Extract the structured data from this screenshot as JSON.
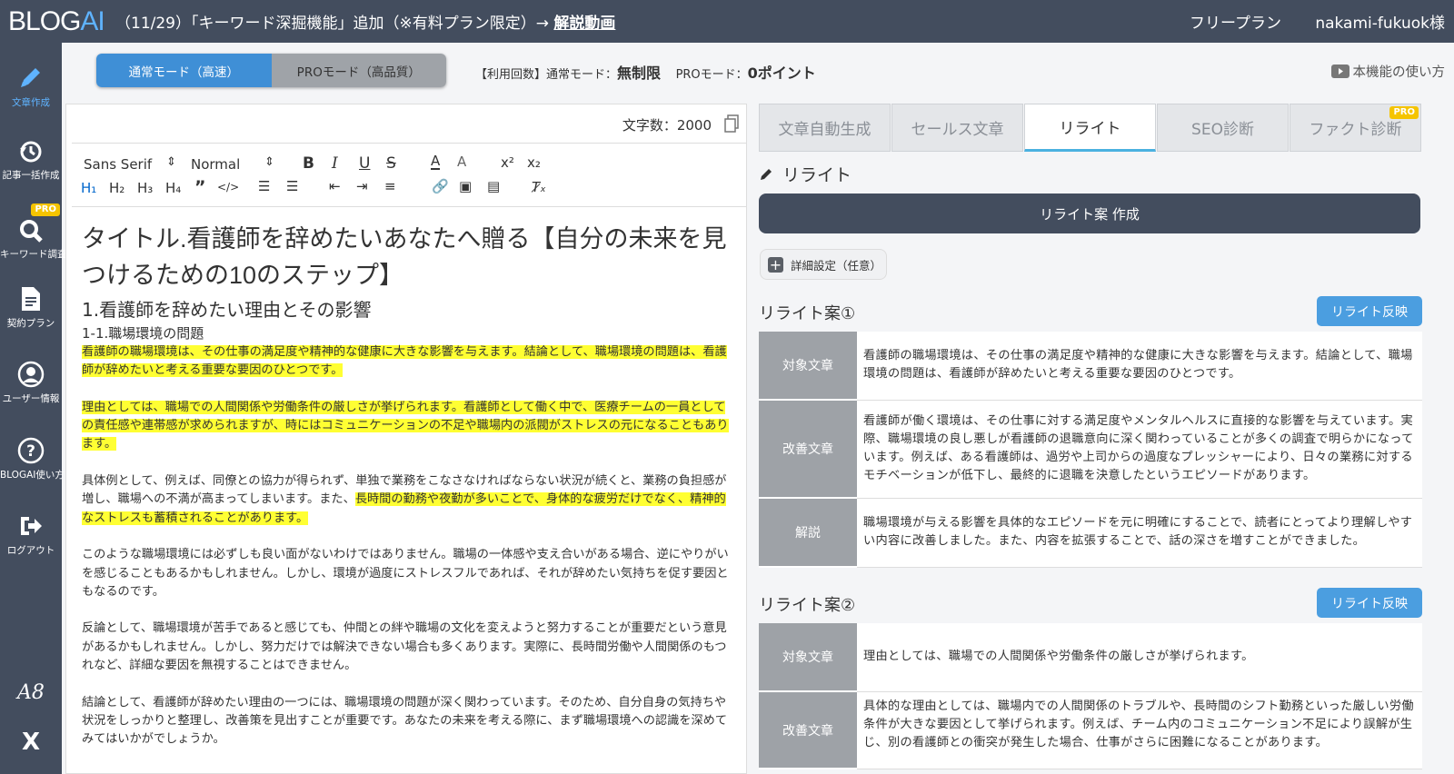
{
  "topbar": {
    "logo_main": "BLOG",
    "logo_accent": "AI",
    "announcement": "（11/29）「キーワード深掘機能」追加（※有料プラン限定）→",
    "announcement_link": "解説動画",
    "plan": "フリープラン",
    "user": "nakami-fukuok様"
  },
  "sidebar": {
    "items": [
      {
        "label": "文章作成",
        "icon": "pencil-icon"
      },
      {
        "label": "記事一括作成",
        "icon": "history-icon"
      },
      {
        "label": "キーワード調査",
        "icon": "search-icon",
        "badge": "PRO"
      },
      {
        "label": "契約プラン",
        "icon": "document-icon"
      },
      {
        "label": "ユーザー情報",
        "icon": "user-icon"
      },
      {
        "label": "BLOGAI使い方",
        "icon": "help-icon"
      },
      {
        "label": "ログアウト",
        "icon": "logout-icon"
      }
    ],
    "footer_a8": "A8",
    "footer_x": "X"
  },
  "modebar": {
    "normal_mode": "通常モード（高速）",
    "pro_mode": "PROモード（高品質）",
    "usage_prefix": "【利用回数】通常モード：",
    "usage_normal": "無制限",
    "usage_pro_prefix": "PROモード：",
    "usage_pro": "0ポイント",
    "howto": "本機能の使い方"
  },
  "editor": {
    "char_count": "文字数：2000",
    "font_select": "Sans Serif",
    "size_select": "Normal",
    "title": "タイトル.看護師を辞めたいあなたへ贈る【自分の未来を見つけるための10のステップ】",
    "h2": "1.看護師を辞めたい理由とその影響",
    "h3": "1-1.職場環境の問題",
    "p1": "看護師の職場環境は、その仕事の満足度や精神的な健康に大きな影響を与えます。結論として、職場環境の問題は、看護師が辞めたいと考える重要な要因のひとつです。",
    "p2": "理由としては、職場での人間関係や労働条件の厳しさが挙げられます。看護師として働く中で、医療チームの一員としての責任感や連帯感が求められますが、時にはコミュニケーションの不足や職場内の派閥がストレスの元になることもあります。",
    "p3a": "具体例として、例えば、同僚との協力が得られず、単独で業務をこなさなければならない状況が続くと、業務の負担感が増し、職場への不満が高まってしまいます。また、",
    "p3b": "長時間の勤務や夜勤が多いことで、身体的な疲労だけでなく、精神的なストレスも蓄積されることがあります。",
    "p4": "このような職場環境には必ずしも良い面がないわけではありません。職場の一体感や支え合いがある場合、逆にやりがいを感じることもあるかもしれません。しかし、環境が過度にストレスフルであれば、それが辞めたい気持ちを促す要因ともなるのです。",
    "p5": "反論として、職場環境が苦手であると感じても、仲間との絆や職場の文化を変えようと努力することが重要だという意見があるかもしれません。しかし、努力だけでは解決できない場合も多くあります。実際に、長時間労働や人間関係のもつれなど、詳細な要因を無視することはできません。",
    "p6": "結論として、看護師が辞めたい理由の一つには、職場環境の問題が深く関わっています。そのため、自分自身の気持ちや状況をしっかりと整理し、改善策を見出すことが重要です。あなたの未来を考える際に、まず職場環境への認識を深めてみてはいかがでしょうか。"
  },
  "tabs": [
    {
      "label": "文章自動生成"
    },
    {
      "label": "セールス文章"
    },
    {
      "label": "リライト"
    },
    {
      "label": "SEO診断"
    },
    {
      "label": "ファクト診断",
      "badge": "PRO"
    }
  ],
  "rewrite": {
    "heading": "リライト",
    "create_button": "リライト案 作成",
    "detail_button": "詳細設定（任意）",
    "apply_label": "リライト反映",
    "label_target": "対象文章",
    "label_improved": "改善文章",
    "label_comment": "解説",
    "proposals": [
      {
        "title": "リライト案①",
        "target": "看護師の職場環境は、その仕事の満足度や精神的な健康に大きな影響を与えます。結論として、職場環境の問題は、看護師が辞めたいと考える重要な要因のひとつです。",
        "improved": "看護師が働く環境は、その仕事に対する満足度やメンタルヘルスに直接的な影響を与えています。実際、職場環境の良し悪しが看護師の退職意向に深く関わっていることが多くの調査で明らかになっています。例えば、ある看護師は、過労や上司からの過度なプレッシャーにより、日々の業務に対するモチベーションが低下し、最終的に退職を決意したというエピソードがあります。",
        "comment": "職場環境が与える影響を具体的なエピソードを元に明確にすることで、読者にとってより理解しやすい内容に改善しました。また、内容を拡張することで、話の深さを増すことができました。"
      },
      {
        "title": "リライト案②",
        "target": "理由としては、職場での人間関係や労働条件の厳しさが挙げられます。",
        "improved": "具体的な理由としては、職場内での人間関係のトラブルや、長時間のシフト勤務といった厳しい労働条件が大きな要因として挙げられます。例えば、チーム内のコミュニケーション不足により誤解が生じ、別の看護師との衝突が発生した場合、仕事がさらに困難になることがあります。"
      }
    ]
  },
  "colors": {
    "sidebar": "#434d5e",
    "accent": "#3f8fd6",
    "highlight": "#ffff33",
    "pro": "#f5c400"
  }
}
